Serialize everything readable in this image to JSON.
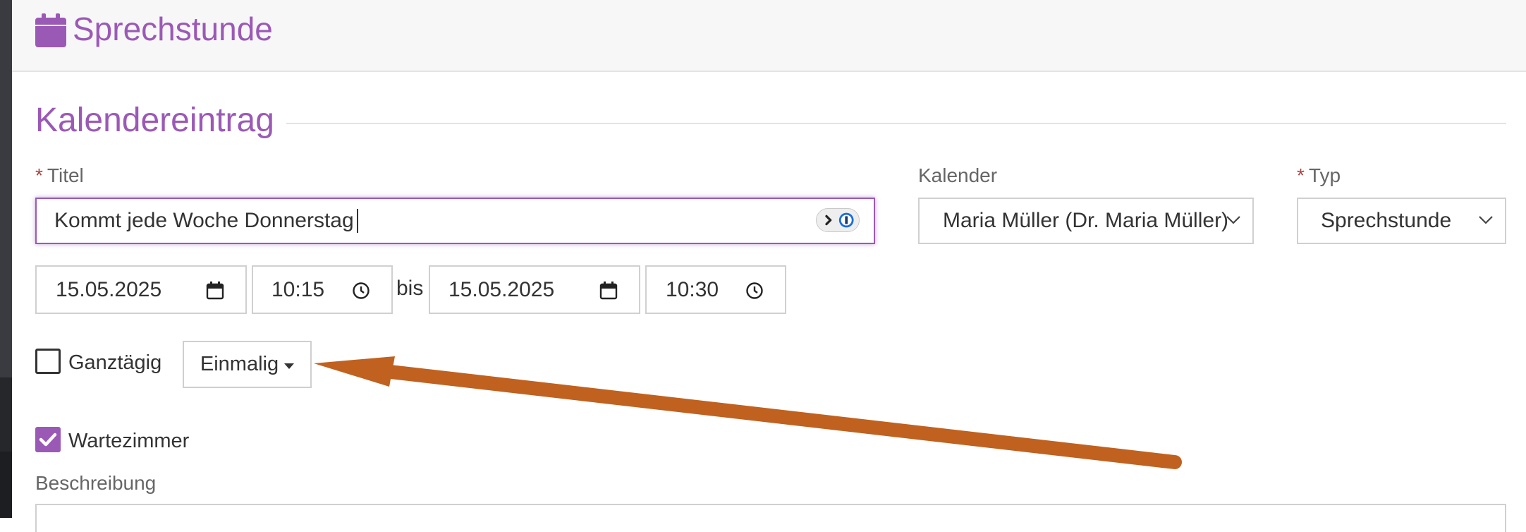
{
  "header": {
    "title": "Sprechstunde",
    "icon": "calendar-icon"
  },
  "section": {
    "title": "Kalendereintrag"
  },
  "form": {
    "titel": {
      "required_mark": "*",
      "label": "Titel",
      "value": "Kommt jede Woche Donnerstag"
    },
    "kalender": {
      "label": "Kalender",
      "value": "Maria Müller (Dr. Maria Müller)"
    },
    "typ": {
      "required_mark": "*",
      "label": "Typ",
      "value": "Sprechstunde"
    },
    "start_date": "15.05.2025",
    "start_time": "10:15",
    "bis": "bis",
    "end_date": "15.05.2025",
    "end_time": "10:30",
    "ganztaegig": {
      "label": "Ganztägig",
      "checked": false
    },
    "recurrence": {
      "label": "Einmalig"
    },
    "wartezimmer": {
      "label": "Wartezimmer",
      "checked": true
    },
    "beschreibung": {
      "label": "Beschreibung"
    }
  },
  "colors": {
    "accent": "#9b59b6",
    "required": "#a94442",
    "arrow": "#c0611f",
    "header_bg": "#f7f7f7",
    "border": "#d0d0d0"
  }
}
